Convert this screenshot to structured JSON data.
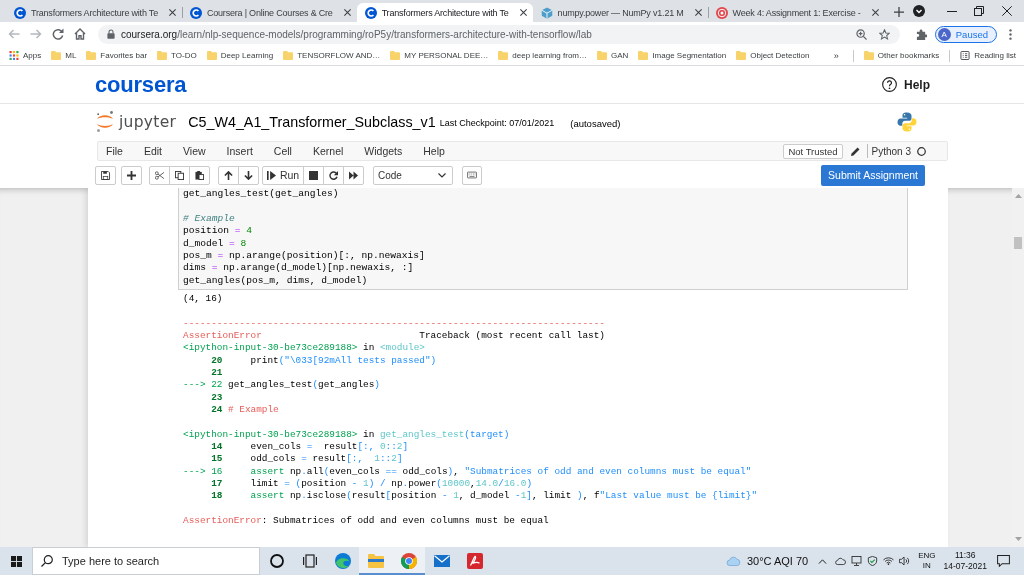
{
  "browser": {
    "tabs": [
      {
        "title": "Transformers Architecture with Te",
        "kind": "coursera",
        "selected": false
      },
      {
        "title": "Coursera | Online Courses & Cre",
        "kind": "coursera",
        "selected": false
      },
      {
        "title": "Transformers Architecture with Te",
        "kind": "coursera",
        "selected": true
      },
      {
        "title": "numpy.power — NumPy v1.21 M",
        "kind": "numpy",
        "selected": false
      },
      {
        "title": "Week 4: Assignment 1: Exercise -",
        "kind": "target",
        "selected": false
      }
    ],
    "address": {
      "host": "coursera.org",
      "path": "/learn/nlp-sequence-models/programming/roP5y/transformers-architecture-with-tensorflow/lab"
    },
    "profile": {
      "initial": "A",
      "status": "Paused"
    },
    "bookmarks": [
      {
        "label": "Apps",
        "kind": "apps"
      },
      {
        "label": "ML",
        "kind": "folder"
      },
      {
        "label": "Favorites bar",
        "kind": "folder"
      },
      {
        "label": "TO-DO",
        "kind": "folder"
      },
      {
        "label": "Deep Learning",
        "kind": "folder"
      },
      {
        "label": "TENSORFLOW AND…",
        "kind": "folder"
      },
      {
        "label": "MY PERSONAL DEE…",
        "kind": "folder"
      },
      {
        "label": "deep learning from…",
        "kind": "folder"
      },
      {
        "label": "GAN",
        "kind": "folder"
      },
      {
        "label": "Image Segmentation",
        "kind": "folder"
      },
      {
        "label": "Object Detection",
        "kind": "folder"
      }
    ],
    "bookmarks_more": "»",
    "bookmarks_right": [
      {
        "label": "Other bookmarks",
        "kind": "folder"
      },
      {
        "label": "Reading list",
        "kind": "reading-list"
      }
    ]
  },
  "site": {
    "logo": "coursera",
    "help": "Help"
  },
  "notebook": {
    "brand": "jupyter",
    "title": "C5_W4_A1_Transformer_Subclass_v1",
    "checkpoint": "Last Checkpoint: 07/01/2021",
    "autosave": "(autosaved)",
    "menu": [
      "File",
      "Edit",
      "View",
      "Insert",
      "Cell",
      "Kernel",
      "Widgets",
      "Help"
    ],
    "trust": "Not Trusted",
    "kernel": "Python 3",
    "kernel_busy": false,
    "run_label": "Run",
    "cell_type": "Code",
    "submit": "Submit Assignment",
    "cell": [
      {
        "kind": "code",
        "tokens": [
          {
            "kind": "plain",
            "text": "get_angles_test(get_angles)"
          }
        ]
      },
      {
        "kind": "blank"
      },
      {
        "kind": "code",
        "tokens": [
          {
            "kind": "comment",
            "text": "# Example"
          }
        ]
      },
      {
        "kind": "code",
        "tokens": [
          {
            "kind": "plain",
            "text": "position "
          },
          {
            "kind": "operator",
            "text": "="
          },
          {
            "kind": "number",
            "text": " 4"
          }
        ]
      },
      {
        "kind": "code",
        "tokens": [
          {
            "kind": "plain",
            "text": "d_model "
          },
          {
            "kind": "operator",
            "text": "="
          },
          {
            "kind": "number",
            "text": " 8"
          }
        ]
      },
      {
        "kind": "code",
        "tokens": [
          {
            "kind": "plain",
            "text": "pos_m "
          },
          {
            "kind": "operator",
            "text": "="
          },
          {
            "kind": "plain",
            "text": " np.arange(position)[:, np.newaxis]"
          }
        ]
      },
      {
        "kind": "code",
        "tokens": [
          {
            "kind": "plain",
            "text": "dims "
          },
          {
            "kind": "operator",
            "text": "="
          },
          {
            "kind": "plain",
            "text": " np.arange(d_model)[np.newaxis, :]"
          }
        ]
      },
      {
        "kind": "code",
        "tokens": [
          {
            "kind": "plain",
            "text": "get_angles(pos_m, dims, d_model)"
          }
        ]
      }
    ],
    "output": "(4, 16)",
    "traceback": [
      {
        "kind": "code",
        "tokens": [
          {
            "kind": "error",
            "text": "---------------------------------------------------------------------------"
          }
        ]
      },
      {
        "kind": "code",
        "tokens": [
          {
            "kind": "error",
            "text": "AssertionError"
          },
          {
            "kind": "plain",
            "text": "                            Traceback (most recent call last)"
          }
        ]
      },
      {
        "kind": "code",
        "tokens": [
          {
            "kind": "file",
            "text": "<ipython-input-30-be73ce289188>"
          },
          {
            "kind": "plain",
            "text": " in "
          },
          {
            "kind": "func",
            "text": "<module>"
          }
        ]
      },
      {
        "kind": "code",
        "tokens": [
          {
            "kind": "lineno",
            "text": "     20"
          },
          {
            "kind": "plain",
            "text": "     print"
          },
          {
            "kind": "operator",
            "text": "("
          },
          {
            "kind": "string",
            "text": "\"\\033[92mAll tests passed\""
          },
          {
            "kind": "operator",
            "text": ")"
          }
        ]
      },
      {
        "kind": "code",
        "tokens": [
          {
            "kind": "lineno",
            "text": "     21"
          }
        ]
      },
      {
        "kind": "code",
        "tokens": [
          {
            "kind": "arrow",
            "text": "---> 22"
          },
          {
            "kind": "plain",
            "text": " get_angles_test"
          },
          {
            "kind": "operator",
            "text": "("
          },
          {
            "kind": "plain",
            "text": "get_angles"
          },
          {
            "kind": "operator",
            "text": ")"
          }
        ]
      },
      {
        "kind": "code",
        "tokens": [
          {
            "kind": "lineno",
            "text": "     23"
          }
        ]
      },
      {
        "kind": "code",
        "tokens": [
          {
            "kind": "lineno",
            "text": "     24"
          },
          {
            "kind": "comment",
            "text": " # Example"
          }
        ]
      },
      {
        "kind": "blank"
      },
      {
        "kind": "code",
        "tokens": [
          {
            "kind": "file",
            "text": "<ipython-input-30-be73ce289188>"
          },
          {
            "kind": "plain",
            "text": " in "
          },
          {
            "kind": "func",
            "text": "get_angles_test"
          },
          {
            "kind": "operator",
            "text": "(target)"
          }
        ]
      },
      {
        "kind": "code",
        "tokens": [
          {
            "kind": "lineno",
            "text": "     14"
          },
          {
            "kind": "plain",
            "text": "     even_cols "
          },
          {
            "kind": "operator",
            "text": "="
          },
          {
            "kind": "plain",
            "text": "  result"
          },
          {
            "kind": "operator",
            "text": "[:, "
          },
          {
            "kind": "number",
            "text": "0"
          },
          {
            "kind": "operator",
            "text": "::"
          },
          {
            "kind": "number",
            "text": "2"
          },
          {
            "kind": "operator",
            "text": "]"
          }
        ]
      },
      {
        "kind": "code",
        "tokens": [
          {
            "kind": "lineno",
            "text": "     15"
          },
          {
            "kind": "plain",
            "text": "     odd_cols "
          },
          {
            "kind": "operator",
            "text": "="
          },
          {
            "kind": "plain",
            "text": " result"
          },
          {
            "kind": "operator",
            "text": "[:,  "
          },
          {
            "kind": "number",
            "text": "1"
          },
          {
            "kind": "operator",
            "text": "::"
          },
          {
            "kind": "number",
            "text": "2"
          },
          {
            "kind": "operator",
            "text": "]"
          }
        ]
      },
      {
        "kind": "code",
        "tokens": [
          {
            "kind": "arrow",
            "text": "---> 16"
          },
          {
            "kind": "keyword",
            "text": "     assert"
          },
          {
            "kind": "plain",
            "text": " np"
          },
          {
            "kind": "operator",
            "text": "."
          },
          {
            "kind": "plain",
            "text": "all"
          },
          {
            "kind": "operator",
            "text": "("
          },
          {
            "kind": "plain",
            "text": "even_cols "
          },
          {
            "kind": "operator",
            "text": "=="
          },
          {
            "kind": "plain",
            "text": " odd_cols"
          },
          {
            "kind": "operator",
            "text": ")"
          },
          {
            "kind": "plain",
            "text": ", "
          },
          {
            "kind": "string",
            "text": "\"Submatrices of odd and even columns must be equal\""
          }
        ]
      },
      {
        "kind": "code",
        "tokens": [
          {
            "kind": "lineno",
            "text": "     17"
          },
          {
            "kind": "plain",
            "text": "     limit "
          },
          {
            "kind": "operator",
            "text": "="
          },
          {
            "kind": "operator",
            "text": " ("
          },
          {
            "kind": "plain",
            "text": "position "
          },
          {
            "kind": "operator",
            "text": "-"
          },
          {
            "kind": "number",
            "text": " 1"
          },
          {
            "kind": "operator",
            "text": ")"
          },
          {
            "kind": "operator",
            "text": " /"
          },
          {
            "kind": "plain",
            "text": " np"
          },
          {
            "kind": "operator",
            "text": "."
          },
          {
            "kind": "plain",
            "text": "power"
          },
          {
            "kind": "operator",
            "text": "("
          },
          {
            "kind": "number",
            "text": "10000"
          },
          {
            "kind": "plain",
            "text": ","
          },
          {
            "kind": "number",
            "text": "14.0"
          },
          {
            "kind": "operator",
            "text": "/"
          },
          {
            "kind": "number",
            "text": "16.0"
          },
          {
            "kind": "operator",
            "text": ")"
          }
        ]
      },
      {
        "kind": "code",
        "tokens": [
          {
            "kind": "lineno",
            "text": "     18"
          },
          {
            "kind": "keyword",
            "text": "     assert"
          },
          {
            "kind": "plain",
            "text": " np"
          },
          {
            "kind": "operator",
            "text": "."
          },
          {
            "kind": "plain",
            "text": "isclose"
          },
          {
            "kind": "operator",
            "text": "("
          },
          {
            "kind": "plain",
            "text": "result"
          },
          {
            "kind": "operator",
            "text": "["
          },
          {
            "kind": "plain",
            "text": "position "
          },
          {
            "kind": "operator",
            "text": "-"
          },
          {
            "kind": "number",
            "text": " 1"
          },
          {
            "kind": "plain",
            "text": ", d_model "
          },
          {
            "kind": "operator",
            "text": "-"
          },
          {
            "kind": "number",
            "text": "1"
          },
          {
            "kind": "operator",
            "text": "]"
          },
          {
            "kind": "plain",
            "text": ", limit "
          },
          {
            "kind": "operator",
            "text": ")"
          },
          {
            "kind": "plain",
            "text": ", f"
          },
          {
            "kind": "string",
            "text": "\"Last value must be {limit}\""
          }
        ]
      },
      {
        "kind": "blank"
      },
      {
        "kind": "code",
        "tokens": [
          {
            "kind": "error",
            "text": "AssertionError"
          },
          {
            "kind": "plain",
            "text": ": Submatrices of odd and even columns must be equal"
          }
        ]
      }
    ]
  },
  "taskbar": {
    "search": {
      "placeholder": "Type here to search"
    },
    "apps": [
      {
        "kind": "cortana",
        "open": false
      },
      {
        "kind": "task-view",
        "open": false
      },
      {
        "kind": "edge",
        "open": false
      },
      {
        "kind": "explorer",
        "open": true
      },
      {
        "kind": "chrome",
        "open": true
      },
      {
        "kind": "mail",
        "open": false
      },
      {
        "kind": "acrobat",
        "open": false
      }
    ],
    "weather": "30°C AQI 70",
    "language": "ENG",
    "region": "IN",
    "time": "11:36",
    "date": "14-07-2021"
  }
}
